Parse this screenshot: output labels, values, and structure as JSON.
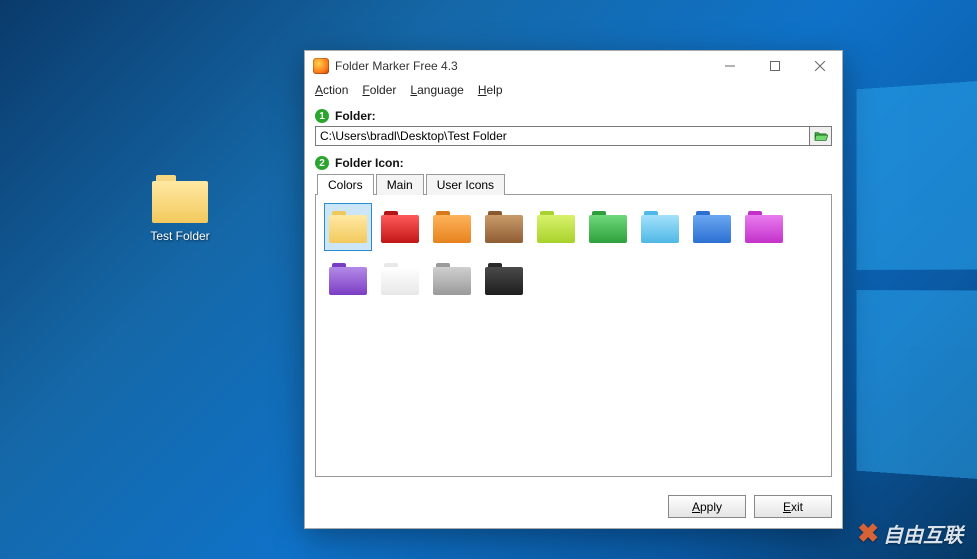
{
  "desktop": {
    "icon_label": "Test Folder",
    "watermark": "自由互联"
  },
  "window": {
    "title": "Folder Marker Free 4.3",
    "menu": {
      "action": "Action",
      "folder": "Folder",
      "language": "Language",
      "help": "Help"
    },
    "section_folder_label": "Folder:",
    "section_folder_num": "1",
    "folder_path": "C:\\Users\\bradl\\Desktop\\Test Folder",
    "section_icon_label": "Folder Icon:",
    "section_icon_num": "2",
    "tabs": {
      "colors": "Colors",
      "main": "Main",
      "user_icons": "User Icons",
      "active": "colors"
    },
    "color_icons": [
      {
        "name": "yellow",
        "tab": "#f0c75a",
        "body_top": "#ffe9a3",
        "body_bot": "#f3c95d",
        "selected": true
      },
      {
        "name": "red",
        "tab": "#b31515",
        "body_top": "#ff5a5a",
        "body_bot": "#c21616",
        "selected": false
      },
      {
        "name": "orange",
        "tab": "#d97a1a",
        "body_top": "#ffb35a",
        "body_bot": "#e6831e",
        "selected": false
      },
      {
        "name": "brown",
        "tab": "#8a5a2e",
        "body_top": "#c99b6a",
        "body_bot": "#8f5e33",
        "selected": false
      },
      {
        "name": "lime",
        "tab": "#a8d22e",
        "body_top": "#d8f26c",
        "body_bot": "#a9d22c",
        "selected": false
      },
      {
        "name": "green",
        "tab": "#2e9e3a",
        "body_top": "#6ed87a",
        "body_bot": "#2fa03c",
        "selected": false
      },
      {
        "name": "lightblue",
        "tab": "#4fb8e6",
        "body_top": "#a4e1fb",
        "body_bot": "#4fb8e6",
        "selected": false
      },
      {
        "name": "blue",
        "tab": "#2a6fd1",
        "body_top": "#6aa6f1",
        "body_bot": "#2b70d2",
        "selected": false
      },
      {
        "name": "magenta",
        "tab": "#c230c9",
        "body_top": "#e97bef",
        "body_bot": "#c332ca",
        "selected": false
      },
      {
        "name": "purple",
        "tab": "#7a3cc2",
        "body_top": "#b48ae8",
        "body_bot": "#7b3dc3",
        "selected": false
      },
      {
        "name": "white",
        "tab": "#e8e8e8",
        "body_top": "#ffffff",
        "body_bot": "#e7e7e7",
        "selected": false
      },
      {
        "name": "gray",
        "tab": "#9a9a9a",
        "body_top": "#cfcfcf",
        "body_bot": "#9a9a9a",
        "selected": false
      },
      {
        "name": "black",
        "tab": "#2a2a2a",
        "body_top": "#4a4a4a",
        "body_bot": "#1e1e1e",
        "selected": false
      }
    ],
    "buttons": {
      "apply": "Apply",
      "exit": "Exit"
    }
  }
}
